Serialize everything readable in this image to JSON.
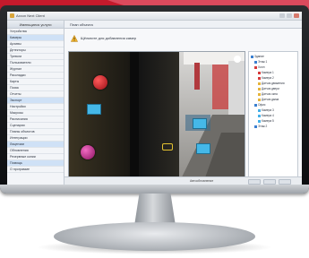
{
  "window": {
    "title": "Axxon Next Client"
  },
  "nav": {
    "header": "Имеющиеся услуги",
    "items": [
      {
        "label": "Устройства",
        "selected": false
      },
      {
        "label": "Камеры",
        "selected": true
      },
      {
        "label": "Архивы",
        "selected": false
      },
      {
        "label": "Детекторы",
        "selected": false
      },
      {
        "label": "Тревоги",
        "selected": false
      },
      {
        "label": "Пользователи",
        "selected": false
      },
      {
        "label": "Журнал",
        "selected": false
      },
      {
        "label": "Раскладки",
        "selected": false
      },
      {
        "label": "Карты",
        "selected": false
      },
      {
        "label": "Поиск",
        "selected": false
      },
      {
        "label": "Отчеты",
        "selected": false
      },
      {
        "label": "Экспорт",
        "selected": true
      },
      {
        "label": "Настройки",
        "selected": false
      },
      {
        "label": "Макросы",
        "selected": false
      },
      {
        "label": "Расписания",
        "selected": false
      },
      {
        "label": "Сценарии",
        "selected": false
      },
      {
        "label": "Планы объектов",
        "selected": false
      },
      {
        "label": "Интеграции",
        "selected": false
      },
      {
        "label": "Лицензии",
        "selected": true
      },
      {
        "label": "Обновления",
        "selected": false
      },
      {
        "label": "Резервные копии",
        "selected": false
      },
      {
        "label": "Помощь",
        "selected": true
      },
      {
        "label": "О программе",
        "selected": false
      }
    ]
  },
  "main": {
    "tab_label": "План объекта",
    "info_text": "Щёлкните для добавления камер"
  },
  "tree": {
    "nodes": [
      {
        "label": "Здание",
        "color": "#3a7fd0",
        "indent": 0
      },
      {
        "label": "Этаж 1",
        "color": "#3a7fd0",
        "indent": 1
      },
      {
        "label": "Холл",
        "color": "#d63a3a",
        "indent": 1
      },
      {
        "label": "Камера 1",
        "color": "#d63a3a",
        "indent": 2
      },
      {
        "label": "Камера 2",
        "color": "#d63a3a",
        "indent": 2
      },
      {
        "label": "Датчик движения",
        "color": "#e5b43a",
        "indent": 2
      },
      {
        "label": "Датчик двери",
        "color": "#e5b43a",
        "indent": 2
      },
      {
        "label": "Датчик окна",
        "color": "#e5b43a",
        "indent": 2
      },
      {
        "label": "Датчик дыма",
        "color": "#e5b43a",
        "indent": 2
      },
      {
        "label": "Офис",
        "color": "#3a7fd0",
        "indent": 1
      },
      {
        "label": "Камера 3",
        "color": "#45b0e8",
        "indent": 2
      },
      {
        "label": "Камера 4",
        "color": "#45b0e8",
        "indent": 2
      },
      {
        "label": "Камера 5",
        "color": "#45b0e8",
        "indent": 2
      },
      {
        "label": "Этаж 2",
        "color": "#3a7fd0",
        "indent": 1
      }
    ]
  },
  "status": {
    "text": "Автообновление"
  },
  "colors": {
    "accent": "#3a7fd0",
    "alarm_red": "#c8202a",
    "marker_cyan": "#45b8e8",
    "marker_magenta": "#c0288a",
    "marker_yellow": "#e3c130"
  }
}
